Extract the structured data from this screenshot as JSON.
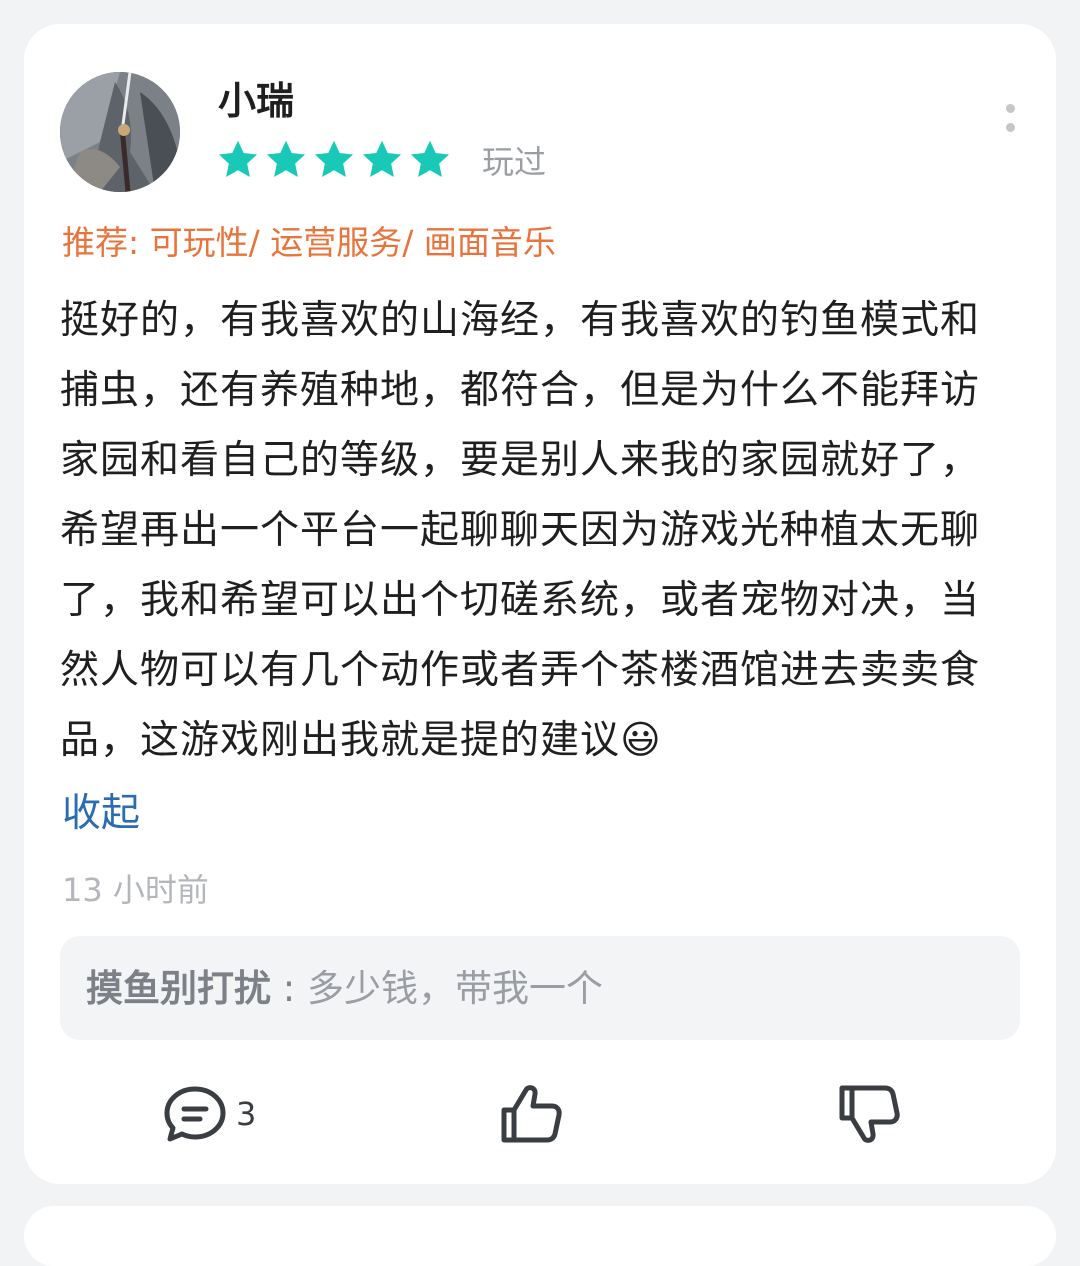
{
  "review": {
    "username": "小瑞",
    "rating": 5,
    "rating_max": 5,
    "status": "玩过",
    "recommend": "推荐: 可玩性/ 运营服务/ 画面音乐",
    "text": "挺好的，有我喜欢的山海经，有我喜欢的钓鱼模式和捕虫，还有养殖种地，都符合，但是为什么不能拜访家园和看自己的等级，要是别人来我的家园就好了，希望再出一个平台一起聊聊天因为游戏光种植太无聊了，我和希望可以出个切磋系统，或者宠物对决，当然人物可以有几个动作或者弄个茶楼酒馆进去卖卖食品，这游戏刚出我就是提的建议😃",
    "collapse_label": "收起",
    "time": "13 小时前"
  },
  "reply": {
    "author": "摸鱼别打扰",
    "separator": " : ",
    "content": "多少钱，带我一个"
  },
  "actions": {
    "comment_count": "3"
  },
  "colors": {
    "star": "#19c9b7",
    "recommend": "#e8733b",
    "link": "#2b6cb0"
  }
}
